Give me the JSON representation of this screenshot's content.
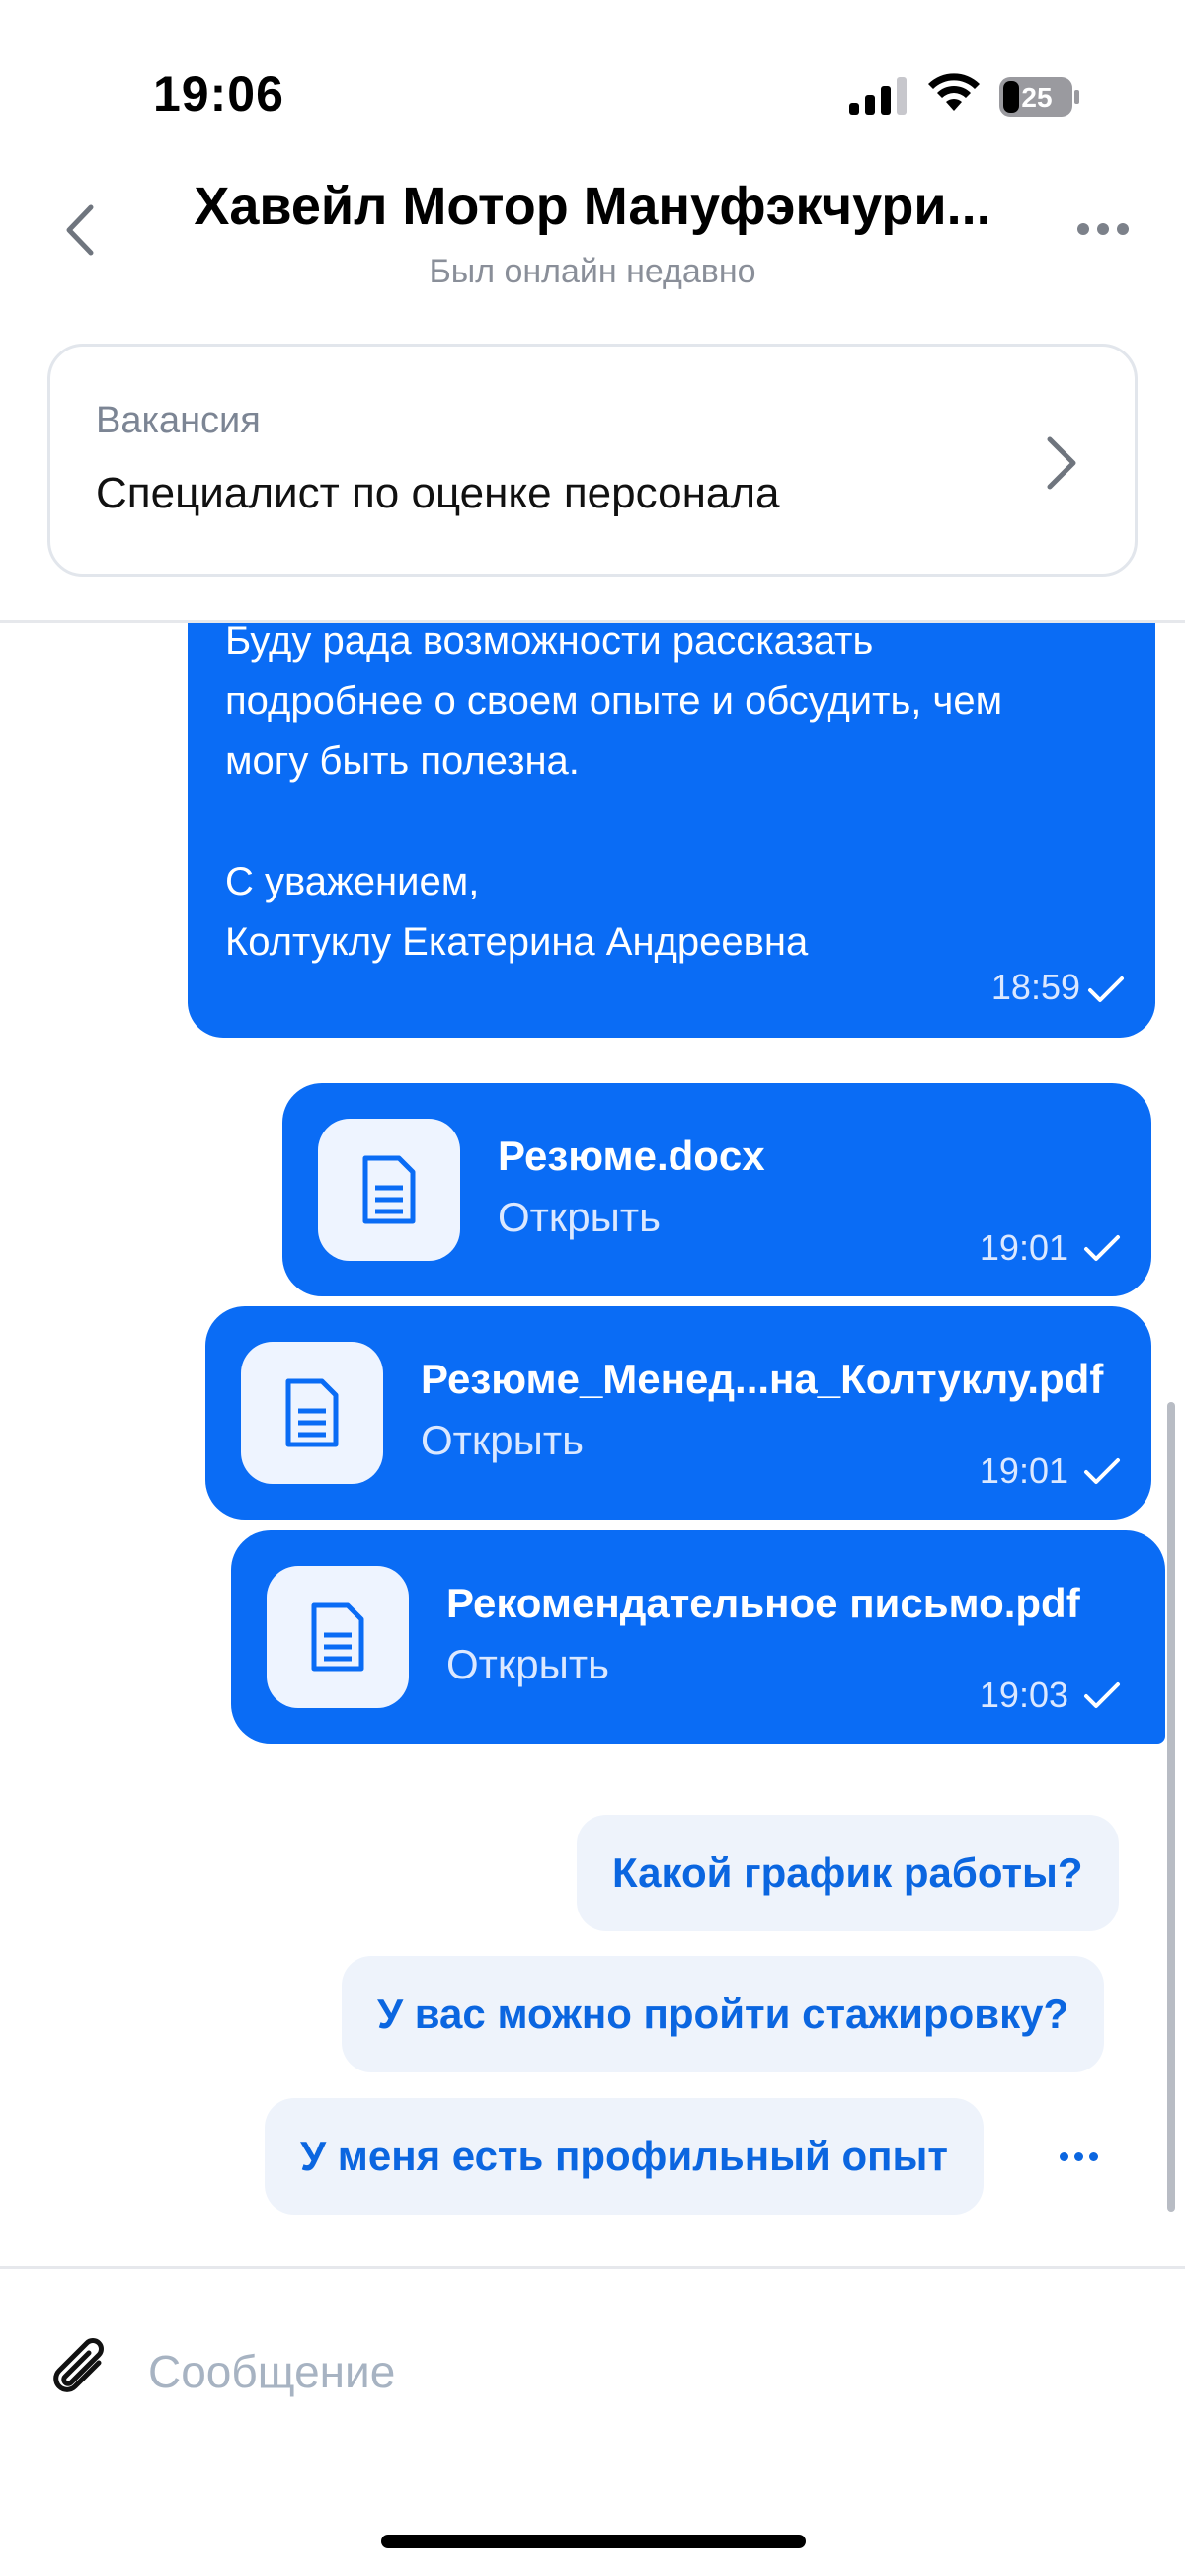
{
  "status_bar": {
    "time": "19:06",
    "battery": "25"
  },
  "header": {
    "title": "Хавейл Мотор Мануфэкчури...",
    "subtitle": "Был онлайн недавно"
  },
  "vacancy": {
    "label": "Вакансия",
    "value": "Специалист по оценке персонала"
  },
  "messages": {
    "text_message": {
      "lines": [
        "Буду рада возможности рассказать",
        "подробнее о своем опыте и обсудить, чем",
        "могу быть полезна.",
        "",
        "С уважением,",
        "Колтуклу Екатерина Андреевна"
      ],
      "time": "18:59"
    },
    "files": [
      {
        "name": "Резюме.docx",
        "action": "Открыть",
        "time": "19:01"
      },
      {
        "name": "Резюме_Менед...на_Колтуклу.pdf",
        "action": "Открыть",
        "time": "19:01"
      },
      {
        "name": "Рекомендательное письмо.pdf",
        "action": "Открыть",
        "time": "19:03"
      }
    ]
  },
  "suggestions": [
    "Какой график работы?",
    "У вас можно пройти стажировку?",
    "У меня есть профильный опыт"
  ],
  "input": {
    "placeholder": "Сообщение"
  },
  "colors": {
    "bubble": "#0a6cf5",
    "accent": "#0b66e0",
    "chip_bg": "#eef3fb"
  }
}
